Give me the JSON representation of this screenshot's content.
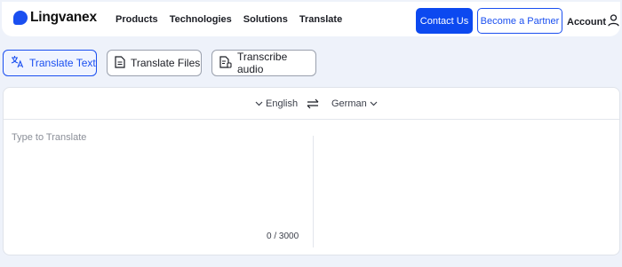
{
  "brand": {
    "name": "Lingvanex",
    "accent": "#1a4ff0"
  },
  "nav": {
    "links": [
      "Products",
      "Technologies",
      "Solutions",
      "Translate"
    ],
    "contact_label": "Contact Us",
    "partner_label": "Become a Partner",
    "account_label": "Account"
  },
  "tabs": [
    {
      "label": "Translate Text",
      "icon": "translate-icon",
      "active": true
    },
    {
      "label": "Translate Files",
      "icon": "file-icon",
      "active": false
    },
    {
      "label": "Transcribe audio",
      "icon": "audio-file-icon",
      "active": false
    }
  ],
  "translator": {
    "source_lang": "English",
    "target_lang": "German",
    "source_placeholder": "Type to Translate",
    "source_value": "",
    "char_count": "0 / 3000"
  }
}
